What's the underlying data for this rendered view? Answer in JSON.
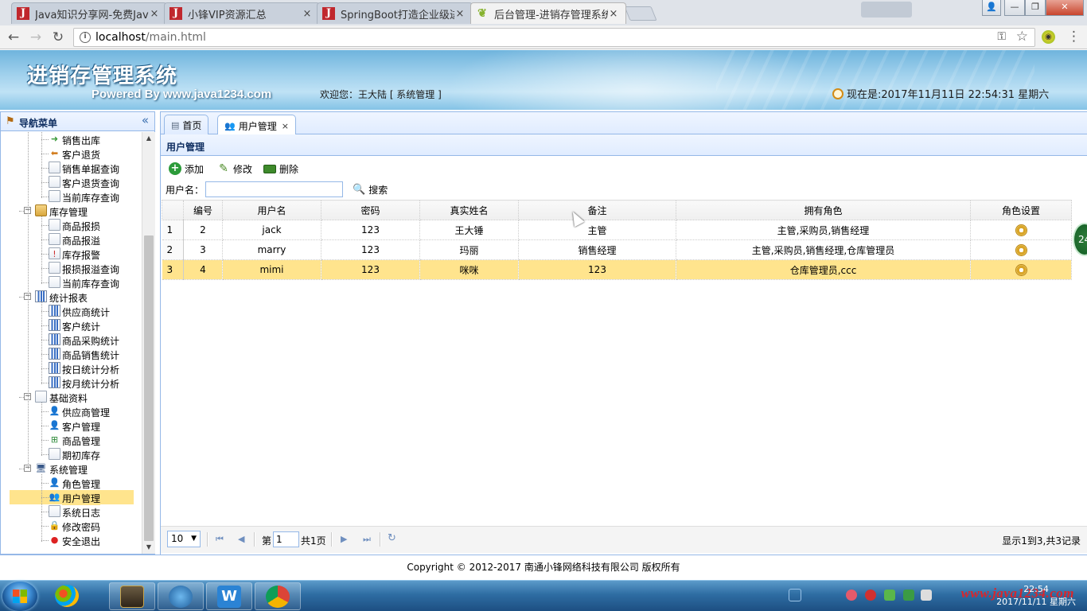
{
  "browser": {
    "tabs": [
      {
        "title": "Java知识分享网-免费Jav",
        "icon": "java-j-icon"
      },
      {
        "title": "小锋VIP资源汇总",
        "icon": "java-j-icon"
      },
      {
        "title": "SpringBoot打造企业级进",
        "icon": "java-j-icon"
      },
      {
        "title": "后台管理-进销存管理系统",
        "icon": "leaf-icon"
      }
    ],
    "url_host": "localhost",
    "url_path": "/main.html",
    "close_glyph": "×"
  },
  "header": {
    "system_title": "进销存管理系统",
    "powered_by": "Powered By www.java1234.com",
    "welcome": "欢迎您：王大陆 [ 系统管理 ]",
    "clock": "现在是:2017年11月11日 22:54:31 星期六"
  },
  "nav": {
    "title": "导航菜单",
    "collapse_glyph": "«",
    "items": [
      {
        "label": "销售出库",
        "level": 2,
        "icon": "arrow-right-icon"
      },
      {
        "label": "客户退货",
        "level": 2,
        "icon": "arrow-left-icon"
      },
      {
        "label": "销售单据查询",
        "level": 2,
        "icon": "doc-search-icon"
      },
      {
        "label": "客户退货查询",
        "level": 2,
        "icon": "doc-search-icon"
      },
      {
        "label": "当前库存查询",
        "level": 2,
        "icon": "doc-icon"
      },
      {
        "label": "库存管理",
        "level": 1,
        "icon": "folder-icon"
      },
      {
        "label": "商品报损",
        "level": 2,
        "icon": "doc-icon"
      },
      {
        "label": "商品报溢",
        "level": 2,
        "icon": "doc-icon"
      },
      {
        "label": "库存报警",
        "level": 2,
        "icon": "alarm-icon"
      },
      {
        "label": "报损报溢查询",
        "level": 2,
        "icon": "doc-search-icon"
      },
      {
        "label": "当前库存查询",
        "level": 2,
        "icon": "doc-icon"
      },
      {
        "label": "统计报表",
        "level": 1,
        "icon": "chart-icon"
      },
      {
        "label": "供应商统计",
        "level": 2,
        "icon": "chart-icon"
      },
      {
        "label": "客户统计",
        "level": 2,
        "icon": "chart-icon"
      },
      {
        "label": "商品采购统计",
        "level": 2,
        "icon": "chart-icon"
      },
      {
        "label": "商品销售统计",
        "level": 2,
        "icon": "chart-icon"
      },
      {
        "label": "按日统计分析",
        "level": 2,
        "icon": "chart-icon"
      },
      {
        "label": "按月统计分析",
        "level": 2,
        "icon": "chart-icon"
      },
      {
        "label": "基础资料",
        "level": 1,
        "icon": "table-icon"
      },
      {
        "label": "供应商管理",
        "level": 2,
        "icon": "user-icon"
      },
      {
        "label": "客户管理",
        "level": 2,
        "icon": "user-icon"
      },
      {
        "label": "商品管理",
        "level": 2,
        "icon": "org-icon"
      },
      {
        "label": "期初库存",
        "level": 2,
        "icon": "doc-icon"
      },
      {
        "label": "系统管理",
        "level": 1,
        "icon": "computer-icon"
      },
      {
        "label": "角色管理",
        "level": 2,
        "icon": "user-icon"
      },
      {
        "label": "用户管理",
        "level": 2,
        "icon": "users-icon",
        "selected": true
      },
      {
        "label": "系统日志",
        "level": 2,
        "icon": "log-icon"
      },
      {
        "label": "修改密码",
        "level": 2,
        "icon": "lock-icon"
      },
      {
        "label": "安全退出",
        "level": 2,
        "icon": "exit-icon"
      }
    ]
  },
  "tabs": {
    "home": "首页",
    "user_mgmt": "用户管理",
    "close_glyph": "×"
  },
  "grid": {
    "title": "用户管理",
    "toolbar": {
      "add": "添加",
      "edit": "修改",
      "delete": "删除"
    },
    "search_label": "用户名：",
    "search_value": "",
    "search_button": "搜索",
    "columns": [
      "编号",
      "用户名",
      "密码",
      "真实姓名",
      "备注",
      "拥有角色",
      "角色设置"
    ],
    "rows": [
      {
        "rownum": "1",
        "id": "2",
        "username": "jack",
        "password": "123",
        "realname": "王大锤",
        "remark": "主管",
        "roles": "主管,采购员,销售经理"
      },
      {
        "rownum": "2",
        "id": "3",
        "username": "marry",
        "password": "123",
        "realname": "玛丽",
        "remark": "销售经理",
        "roles": "主管,采购员,销售经理,仓库管理员"
      },
      {
        "rownum": "3",
        "id": "4",
        "username": "mimi",
        "password": "123",
        "realname": "咪咪",
        "remark": "123",
        "roles": "仓库管理员,ccc",
        "selected": true
      }
    ],
    "pager": {
      "page_size": "10",
      "page_prefix": "第",
      "page_number": "1",
      "page_total": "共1页",
      "info": "显示1到3,共3记录"
    }
  },
  "footer": {
    "copyright": "Copyright © 2012-2017 南通小锋网络科技有限公司 版权所有"
  },
  "side_badge": "24",
  "taskbar": {
    "time": "22:54",
    "date": "2017/11/11 星期六",
    "watermark": "www.java1234.com"
  },
  "colors": {
    "panel_border": "#95b8e7",
    "selected_row": "#ffe48d",
    "header_blue": "#6fb4dd"
  }
}
